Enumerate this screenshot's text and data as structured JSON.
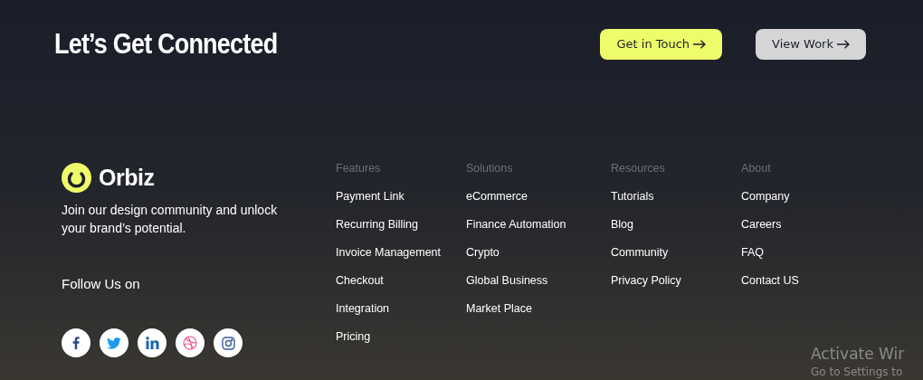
{
  "header": {
    "title": "Let’s Get Connected",
    "buttons": [
      {
        "label": "Get in Touch",
        "kind": "primary"
      },
      {
        "label": "View Work",
        "kind": "secondary"
      }
    ]
  },
  "brand": {
    "name": "Orbiz",
    "tagline": "Join our design community and unlock your brand’s potential.",
    "follow_label": "Follow Us on"
  },
  "social": [
    {
      "kind": "facebook"
    },
    {
      "kind": "twitter"
    },
    {
      "kind": "linkedin"
    },
    {
      "kind": "dribbble"
    },
    {
      "kind": "instagram"
    }
  ],
  "columns": [
    {
      "heading": "Features",
      "links": [
        "Payment Link",
        "Recurring Billing",
        "Invoice Management",
        "Checkout",
        "Integration",
        "Pricing"
      ]
    },
    {
      "heading": "Solutions",
      "links": [
        "eCommerce",
        "Finance Automation",
        "Crypto",
        "Global Business",
        "Market Place"
      ]
    },
    {
      "heading": "Resources",
      "links": [
        "Tutorials",
        "Blog",
        "Community",
        "Privacy Policy"
      ]
    },
    {
      "heading": "About",
      "links": [
        "Company",
        "Careers",
        "FAQ",
        "Contact US"
      ]
    }
  ],
  "os_notice": {
    "title": "Activate Wir",
    "subtitle": "Go to Settings to"
  }
}
